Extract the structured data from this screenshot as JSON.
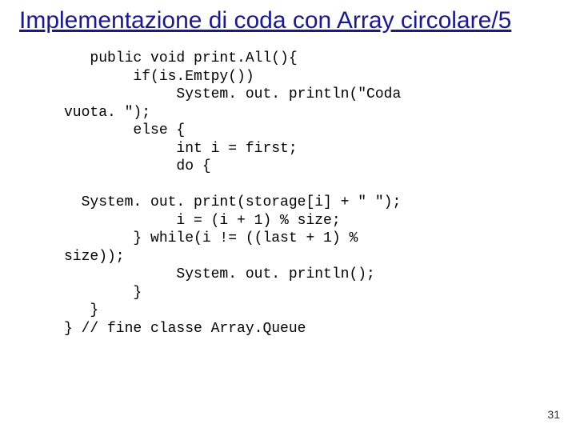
{
  "title": "Implementazione di coda con Array circolare/5",
  "code": "   public void print.All(){\n        if(is.Emtpy())\n             System. out. println(\"Coda\nvuota. \");\n        else {\n             int i = first;\n             do {\n\n  System. out. print(storage[i] + \" \");\n             i = (i + 1) % size;\n        } while(i != ((last + 1) %\nsize));\n             System. out. println();\n        }\n   }\n} // fine classe Array.Queue",
  "page_number": "31"
}
